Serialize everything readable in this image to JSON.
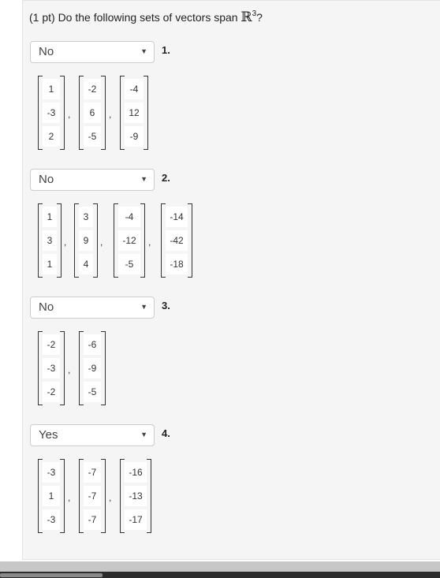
{
  "question": {
    "prefix": "(1 pt) Do the following sets of vectors span ",
    "space_symbol": "ℝ",
    "space_dim": "3",
    "suffix": "?"
  },
  "items": [
    {
      "number": "1.",
      "answer": "No",
      "vectors": [
        [
          "1",
          "-3",
          "2"
        ],
        [
          "-2",
          "6",
          "-5"
        ],
        [
          "-4",
          "12",
          "-9"
        ]
      ]
    },
    {
      "number": "2.",
      "answer": "No",
      "vectors": [
        [
          "1",
          "3",
          "1"
        ],
        [
          "3",
          "9",
          "4"
        ],
        [
          "-4",
          "-12",
          "-5"
        ],
        [
          "-14",
          "-42",
          "-18"
        ]
      ]
    },
    {
      "number": "3.",
      "answer": "No",
      "vectors": [
        [
          "-2",
          "-3",
          "-2"
        ],
        [
          "-6",
          "-9",
          "-5"
        ]
      ]
    },
    {
      "number": "4.",
      "answer": "Yes",
      "vectors": [
        [
          "-3",
          "1",
          "-3"
        ],
        [
          "-7",
          "-7",
          "-7"
        ],
        [
          "-16",
          "-13",
          "-17"
        ]
      ]
    }
  ],
  "comma": ","
}
